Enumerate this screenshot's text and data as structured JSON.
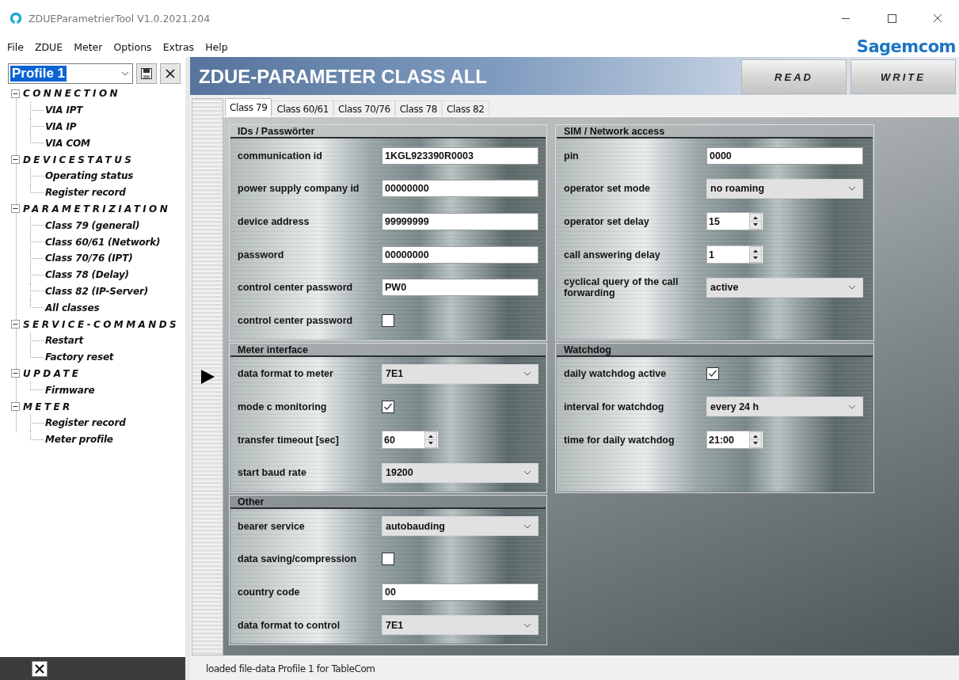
{
  "window": {
    "title": "ZDUEParametrierTool V1.0.2021.204"
  },
  "menu": [
    "File",
    "ZDUE",
    "Meter",
    "Options",
    "Extras",
    "Help"
  ],
  "logo": "Sagemcom",
  "profile": {
    "value": "Profile 1"
  },
  "tree": [
    {
      "label": "CONNECTION",
      "expanded": true,
      "children": [
        {
          "label": "VIA IPT"
        },
        {
          "label": "VIA IP"
        },
        {
          "label": "VIA COM"
        }
      ]
    },
    {
      "label": "DEVICESTATUS",
      "expanded": true,
      "children": [
        {
          "label": "Operating status"
        },
        {
          "label": "Register record"
        }
      ]
    },
    {
      "label": "PARAMETRIZIATION",
      "expanded": true,
      "children": [
        {
          "label": "Class 79 (general)"
        },
        {
          "label": "Class 60/61 (Network)"
        },
        {
          "label": "Class 70/76 (IPT)"
        },
        {
          "label": "Class 78 (Delay)"
        },
        {
          "label": "Class 82 (IP-Server)"
        },
        {
          "label": "All classes"
        }
      ]
    },
    {
      "label": "SERVICE-COMMANDS",
      "expanded": true,
      "children": [
        {
          "label": "Restart"
        },
        {
          "label": "Factory reset"
        }
      ]
    },
    {
      "label": "UPDATE",
      "expanded": true,
      "children": [
        {
          "label": "Firmware"
        }
      ]
    },
    {
      "label": "METER",
      "expanded": true,
      "children": [
        {
          "label": "Register record"
        },
        {
          "label": "Meter profile"
        }
      ]
    }
  ],
  "header": {
    "title": "ZDUE-PARAMETER CLASS ALL",
    "buttons": [
      "READ",
      "WRITE"
    ]
  },
  "tabs": [
    {
      "label": "Class 79",
      "selected": true
    },
    {
      "label": "Class 60/61",
      "selected": false
    },
    {
      "label": "Class 70/76",
      "selected": false
    },
    {
      "label": "Class 78",
      "selected": false
    },
    {
      "label": "Class 82",
      "selected": false
    }
  ],
  "groups": [
    {
      "title": "IDs / Passwörter",
      "fields": [
        {
          "kind": "text",
          "label": "communication id",
          "value": "1KGL923390R0003"
        },
        {
          "kind": "text",
          "label": "power supply company id",
          "value": "00000000"
        },
        {
          "kind": "text",
          "label": "device address",
          "value": "99999999"
        },
        {
          "kind": "text",
          "label": "password",
          "value": "00000000"
        },
        {
          "kind": "text",
          "label": "control center password",
          "value": "PW0"
        },
        {
          "kind": "checkbox",
          "label": "control center password",
          "checked": false
        }
      ]
    },
    {
      "title": "SIM / Network access",
      "fields": [
        {
          "kind": "text",
          "label": "pin",
          "value": "0000"
        },
        {
          "kind": "select",
          "label": "operator set mode",
          "value": "no roaming"
        },
        {
          "kind": "spin",
          "label": "operator set delay",
          "value": "15"
        },
        {
          "kind": "spin",
          "label": "call answering delay",
          "value": "1"
        },
        {
          "kind": "select",
          "label": "cyclical query of the call forwarding",
          "value": "active"
        }
      ]
    },
    {
      "title": "Meter interface",
      "fields": [
        {
          "kind": "select",
          "label": "data format to meter",
          "value": "7E1"
        },
        {
          "kind": "checkbox",
          "label": "mode c monitoring",
          "checked": true
        },
        {
          "kind": "spin",
          "label": "transfer timeout [sec]",
          "value": "60"
        },
        {
          "kind": "select",
          "label": "start baud rate",
          "value": "19200"
        }
      ]
    },
    {
      "title": "Watchdog",
      "fields": [
        {
          "kind": "checkbox",
          "label": "daily watchdog active",
          "checked": true
        },
        {
          "kind": "select",
          "label": "interval for watchdog",
          "value": "every 24 h"
        },
        {
          "kind": "spin",
          "label": "time for daily watchdog",
          "value": "21:00"
        }
      ]
    },
    {
      "title": "Other",
      "fields": [
        {
          "kind": "select",
          "label": "bearer service",
          "value": "autobauding"
        },
        {
          "kind": "checkbox",
          "label": "data saving/compression",
          "checked": false
        },
        {
          "kind": "text",
          "label": "country code",
          "value": "00"
        },
        {
          "kind": "select",
          "label": "data format to control",
          "value": "7E1"
        }
      ]
    }
  ],
  "status": "loaded file-data Profile 1 for TableCom"
}
